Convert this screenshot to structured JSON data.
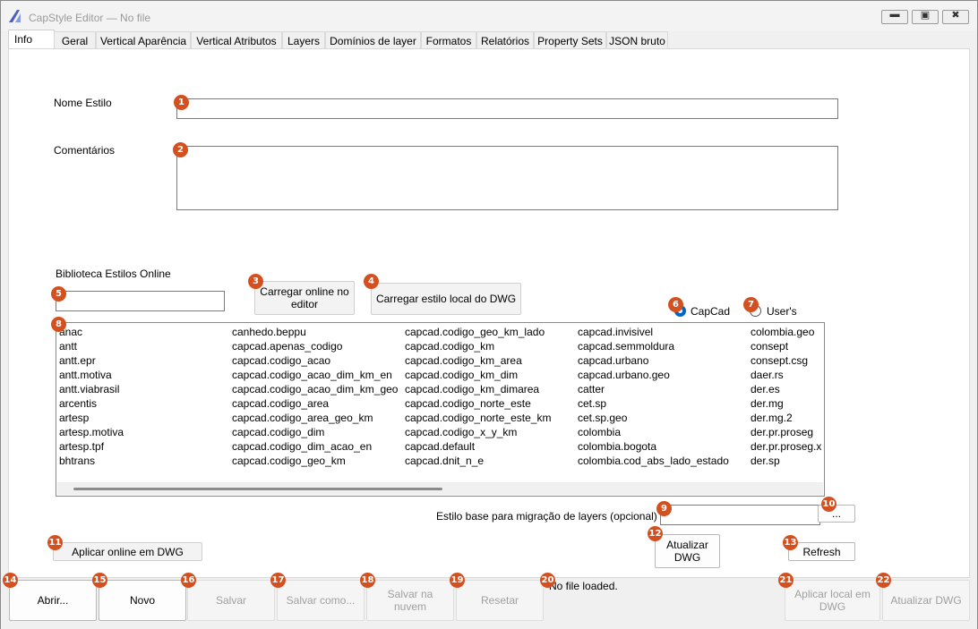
{
  "window": {
    "title": "CapStyle Editor — No file"
  },
  "tabs": [
    "Info",
    "Geral",
    "Vertical Aparência",
    "Vertical Atributos",
    "Layers",
    "Domínios de layer",
    "Formatos",
    "Relatórios",
    "Property Sets",
    "JSON bruto"
  ],
  "form": {
    "nome_estilo_label": "Nome Estilo",
    "nome_estilo_value": "",
    "comentarios_label": "Comentários",
    "comentarios_value": "",
    "biblioteca_label": "Biblioteca Estilos Online",
    "search_value": "",
    "carregar_online_label": "Carregar online no editor",
    "carregar_local_label": "Carregar estilo local do DWG",
    "radio_capcad_label": "CapCad",
    "radio_users_label": "User's",
    "selected_source": "CapCad",
    "estilo_base_label": "Estilo base para migração de layers (opcional)",
    "estilo_base_value": "",
    "browse_label": "...",
    "aplicar_online_label": "Aplicar online em DWG",
    "atualizar_dwg_label": "Atualizar DWG",
    "refresh_label": "Refresh"
  },
  "styles_list": {
    "columns": [
      [
        "anac",
        "antt",
        "antt.epr",
        "antt.motiva",
        "antt.viabrasil",
        "arcentis",
        "artesp",
        "artesp.motiva",
        "artesp.tpf",
        "bhtrans"
      ],
      [
        "canhedo.beppu",
        "capcad.apenas_codigo",
        "capcad.codigo_acao",
        "capcad.codigo_acao_dim_km_en",
        "capcad.codigo_acao_dim_km_geo",
        "capcad.codigo_area",
        "capcad.codigo_area_geo_km",
        "capcad.codigo_dim",
        "capcad.codigo_dim_acao_en",
        "capcad.codigo_geo_km"
      ],
      [
        "capcad.codigo_geo_km_lado",
        "capcad.codigo_km",
        "capcad.codigo_km_area",
        "capcad.codigo_km_dim",
        "capcad.codigo_km_dimarea",
        "capcad.codigo_norte_este",
        "capcad.codigo_norte_este_km",
        "capcad.codigo_x_y_km",
        "capcad.default",
        "capcad.dnit_n_e"
      ],
      [
        "capcad.invisivel",
        "capcad.semmoldura",
        "capcad.urbano",
        "capcad.urbano.geo",
        "catter",
        "cet.sp",
        "cet.sp.geo",
        "colombia",
        "colombia.bogota",
        "colombia.cod_abs_lado_estado"
      ],
      [
        "colombia.geo",
        "consept",
        "consept.csg",
        "daer.rs",
        "der.es",
        "der.mg",
        "der.mg.2",
        "der.pr.proseg",
        "der.pr.proseg.x",
        "der.sp"
      ]
    ]
  },
  "bottom": {
    "abrir": "Abrir...",
    "novo": "Novo",
    "salvar": "Salvar",
    "salvar_como": "Salvar como...",
    "salvar_nuvem": "Salvar na nuvem",
    "resetar": "Resetar",
    "status": "No file loaded.",
    "aplicar_local": "Aplicar local em DWG",
    "atualizar_dwg": "Atualizar DWG"
  },
  "badges": [
    "1",
    "2",
    "3",
    "4",
    "5",
    "6",
    "7",
    "8",
    "9",
    "10",
    "11",
    "12",
    "13",
    "14",
    "15",
    "16",
    "17",
    "18",
    "19",
    "20",
    "21",
    "22"
  ],
  "colors": {
    "badge": "#d4501e",
    "accent": "#0067c0",
    "app_icon": "#4a5fc1"
  }
}
